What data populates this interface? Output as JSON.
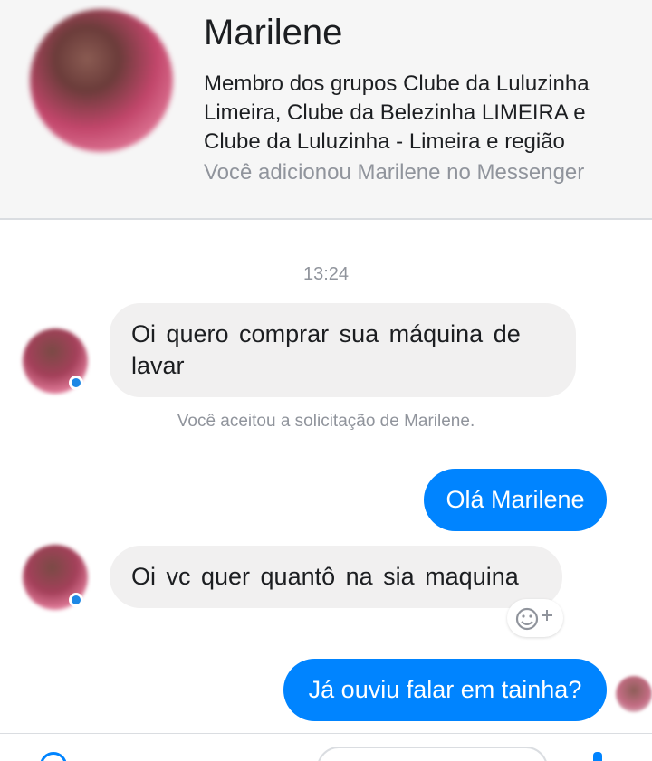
{
  "profile": {
    "name": "Marilene",
    "bio": "Membro dos grupos Clube da Luluzinha Limeira, Clube da Belezinha LIMEIRA e Clube da Luluzinha - Limeira e região",
    "added_note": "Você adicionou Marilene no Messenger"
  },
  "chat": {
    "timestamp": "13:24",
    "messages": [
      {
        "direction": "incoming",
        "text": "Oi quero comprar sua máquina de lavar"
      },
      {
        "direction": "outgoing",
        "text": "Olá Marilene"
      },
      {
        "direction": "incoming",
        "text": "Oi vc quer quantô na sia maquina"
      },
      {
        "direction": "outgoing",
        "text": "Já ouviu falar em tainha?"
      }
    ],
    "system_message": "Você aceitou a solicitação de Marilene."
  },
  "icons": {
    "reaction": "add-reaction-icon",
    "online": "online-status-icon",
    "read_receipt": "seen-avatar-icon"
  },
  "colors": {
    "outgoing_bubble": "#0084ff",
    "incoming_bubble": "#f1f0f0",
    "muted_text": "#90949c",
    "online_dot": "#1e88e5"
  }
}
